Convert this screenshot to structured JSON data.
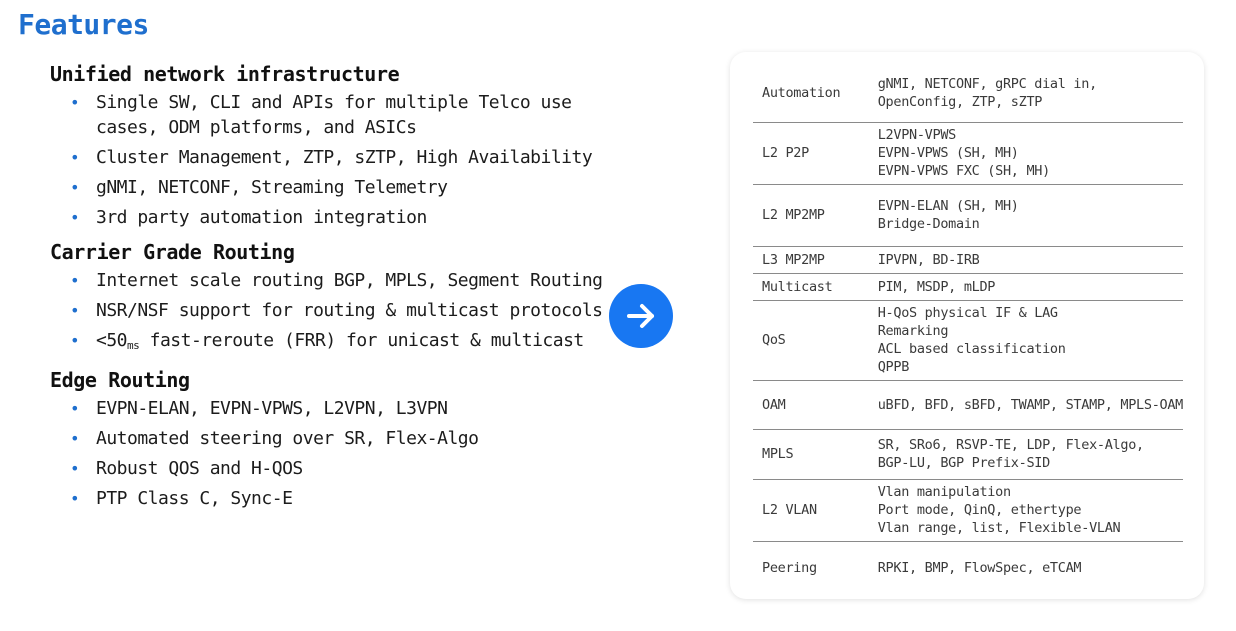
{
  "page": {
    "title": "Features",
    "accent_color": "#1f6fce",
    "arrow_icon": "arrow-right-icon",
    "arrow_color": "#1877f2"
  },
  "sections": [
    {
      "heading": "Unified network infrastructure",
      "bullets": [
        {
          "text": "Single SW, CLI and APIs for multiple Telco use cases, ODM platforms, and ASICs"
        },
        {
          "text": "Cluster Management, ZTP, sZTP, High Availability"
        },
        {
          "text": "gNMI, NETCONF, Streaming Telemetry"
        },
        {
          "text": "3rd party automation integration"
        }
      ]
    },
    {
      "heading": "Carrier Grade Routing",
      "bullets": [
        {
          "text": "Internet scale routing BGP, MPLS, Segment Routing"
        },
        {
          "text": "NSR/NSF support for routing & multicast protocols"
        },
        {
          "text": "<50",
          "sub": "ms",
          "after": " fast-reroute (FRR) for unicast & multicast"
        }
      ]
    },
    {
      "heading": "Edge Routing",
      "bullets": [
        {
          "text": "EVPN-ELAN, EVPN-VPWS, L2VPN, L3VPN"
        },
        {
          "text": "Automated steering over SR, Flex-Algo"
        },
        {
          "text": "Robust QOS and H-QOS"
        },
        {
          "text": "PTP Class C, Sync-E"
        }
      ]
    }
  ],
  "table": {
    "rows": [
      {
        "category": "Automation",
        "lines": [
          "gNMI, NETCONF, gRPC dial in,",
          "OpenConfig, ZTP, sZTP"
        ]
      },
      {
        "category": "L2 P2P",
        "lines": [
          "L2VPN-VPWS",
          "EVPN-VPWS (SH, MH)",
          "EVPN-VPWS FXC (SH, MH)"
        ]
      },
      {
        "category": "L2 MP2MP",
        "lines": [
          "EVPN-ELAN (SH, MH)",
          "Bridge-Domain"
        ]
      },
      {
        "category": "L3 MP2MP",
        "lines": [
          "IPVPN, BD-IRB"
        ]
      },
      {
        "category": "Multicast",
        "lines": [
          "PIM, MSDP, mLDP"
        ]
      },
      {
        "category": "QoS",
        "lines": [
          "H-QoS physical IF & LAG",
          "Remarking",
          "ACL based classification",
          "QPPB"
        ]
      },
      {
        "category": "OAM",
        "lines": [
          "uBFD, BFD, sBFD, TWAMP, STAMP, MPLS-OAM"
        ]
      },
      {
        "category": "MPLS",
        "lines": [
          "SR, SRo6, RSVP-TE, LDP, Flex-Algo,",
          "BGP-LU, BGP Prefix-SID"
        ]
      },
      {
        "category": "L2 VLAN",
        "lines": [
          "Vlan manipulation",
          "Port mode, QinQ, ethertype",
          "Vlan range, list, Flexible-VLAN"
        ]
      },
      {
        "category": "Peering",
        "lines": [
          "RPKI, BMP, FlowSpec, eTCAM"
        ]
      }
    ]
  }
}
